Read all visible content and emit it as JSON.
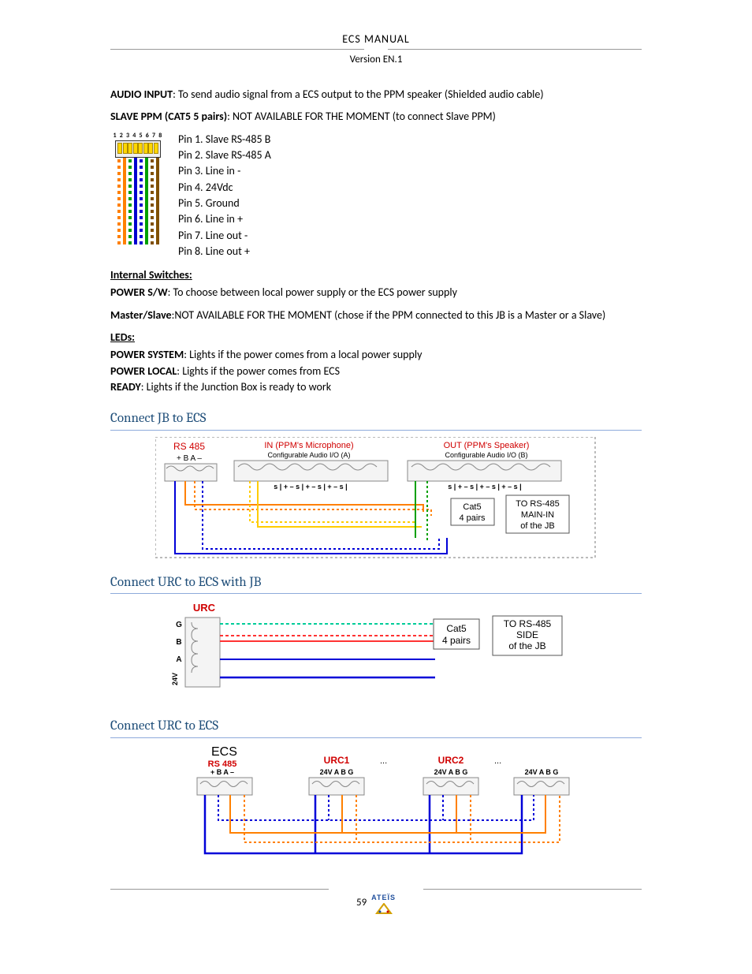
{
  "header": {
    "title": "ECS  MANUAL",
    "version": "Version EN.1"
  },
  "body": {
    "audio_input_label": "AUDIO INPUT",
    "audio_input_text": ": To send audio signal from a ECS output to the PPM speaker (Shielded audio cable)",
    "slave_ppm_label": "SLAVE PPM (CAT5 5 pairs)",
    "slave_ppm_text": ": NOT AVAILABLE FOR THE MOMENT (to connect Slave PPM)",
    "pins": [
      "Pin 1. Slave RS-485 B",
      "Pin 2. Slave RS-485 A",
      "Pin 3. Line in -",
      "Pin 4. 24Vdc",
      "Pin 5. Ground",
      "Pin 6. Line in +",
      "Pin 7. Line out -",
      "Pin 8. Line out +"
    ],
    "internal_switches_heading": "Internal Switches:",
    "power_sw_label": "POWER S/W",
    "power_sw_text": ": To choose between local power supply or the ECS power supply",
    "master_slave_label": "Master/Slave",
    "master_slave_text": ":NOT AVAILABLE FOR THE MOMENT (chose if the PPM connected to this JB is a Master or a Slave)",
    "leds_heading": "LEDs:",
    "power_system_label": "POWER SYSTEM",
    "power_system_text": ": Lights if the power comes from a local power supply",
    "power_local_label": "POWER LOCAL",
    "power_local_text": ": Lights if the power comes from ECS",
    "ready_label": "READY",
    "ready_text": ": Lights if the Junction Box is ready to work"
  },
  "headings": {
    "h1": "Connect JB to ECS",
    "h2": "Connect URC to ECS with JB",
    "h3": "Connect URC to ECS"
  },
  "diagram1": {
    "rs485": "RS 485",
    "rs485_pins": "+  B  A  –",
    "in_title": "IN (PPM's Microphone)",
    "in_sub": "Configurable Audio I/O (A)",
    "out_title": "OUT (PPM's Speaker)",
    "out_sub": "Configurable Audio I/O (B)",
    "terminal_labels": "s | +    –    s | +    –    s | +    –    s |",
    "cat5": "Cat5",
    "cat5_sub": "4 pairs",
    "to_label1": "TO RS-485",
    "to_label2": "MAIN-IN",
    "to_label3": "of the JB"
  },
  "diagram2": {
    "urc": "URC",
    "pins": [
      "G",
      "B",
      "A",
      "24V"
    ],
    "cat5": "Cat5",
    "cat5_sub": "4 pairs",
    "to_label1": "TO RS-485",
    "to_label2": "SIDE",
    "to_label3": "of the JB"
  },
  "diagram3": {
    "ecs": "ECS",
    "rs485": "RS 485",
    "rs485_pins": "+  B  A  –",
    "urc1": "URC1",
    "urc2": "URC2",
    "dots": "...",
    "pin_labels": "24V  A   B   G"
  },
  "footer": {
    "page": "59",
    "brand": "ATEÏS"
  }
}
